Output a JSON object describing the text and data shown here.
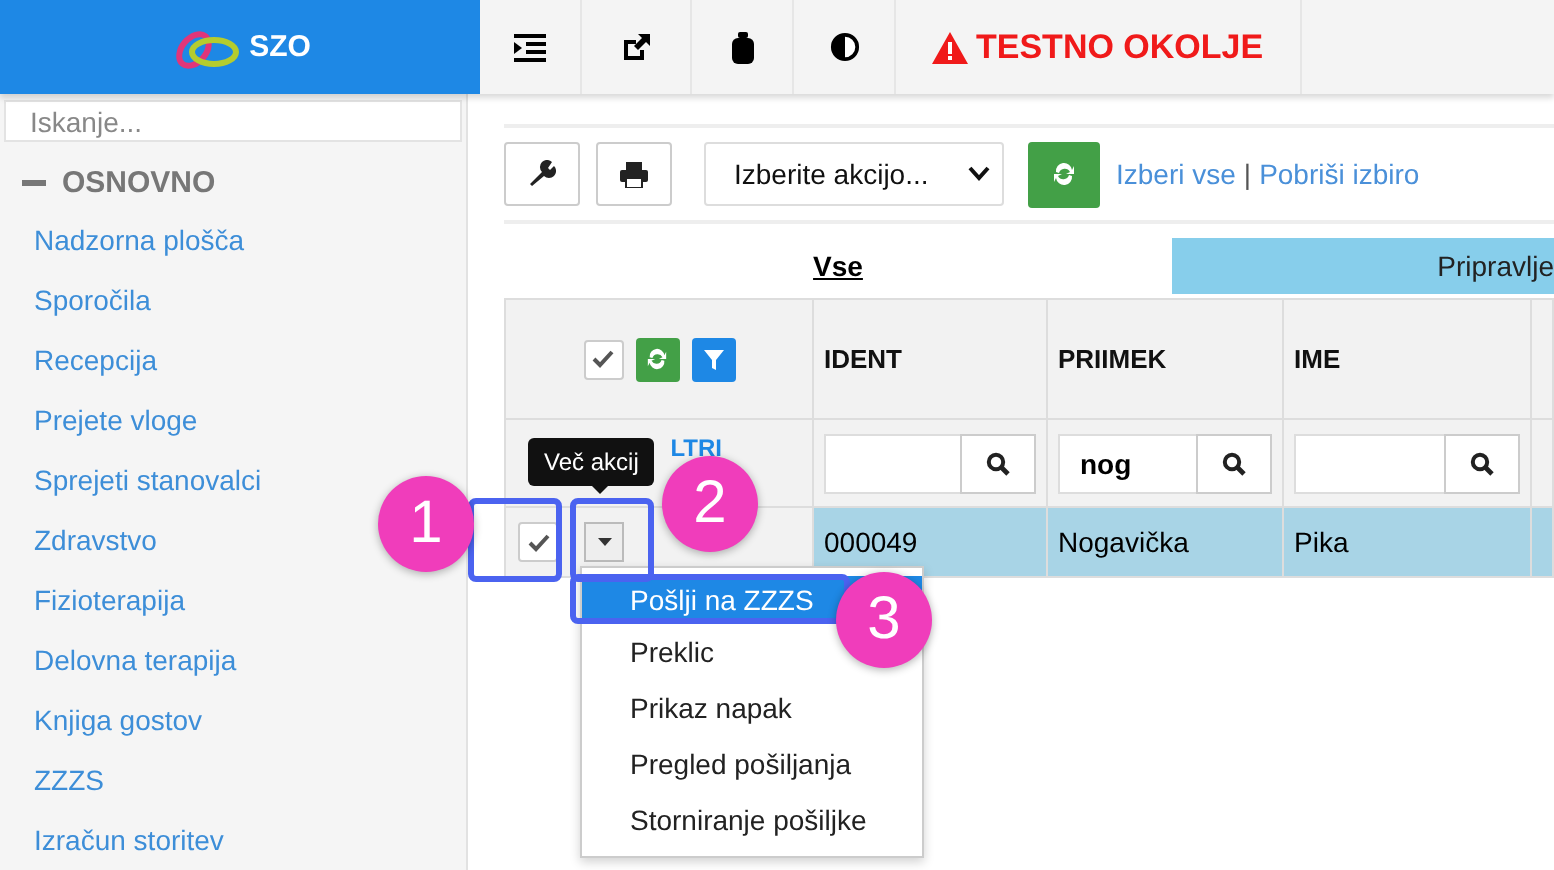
{
  "header": {
    "logo_text": "SZO",
    "alert": "TESTNO OKOLJE"
  },
  "sidebar": {
    "search": {
      "placeholder": "Iskanje..."
    },
    "section": {
      "label": "OSNOVNO",
      "expanded": true
    },
    "items": [
      "Nadzorna plošča",
      "Sporočila",
      "Recepcija",
      "Prejete vloge",
      "Sprejeti stanovalci",
      "Zdravstvo",
      "Fizioterapija",
      "Delovna terapija",
      "Knjiga gostov",
      "ZZZS",
      "Izračun storitev"
    ]
  },
  "toolbar": {
    "select": "Izberite akcijo...",
    "links": [
      "Izberi vse",
      "Pobriši izbiro"
    ],
    "separator": "|"
  },
  "tabs": [
    {
      "label": "Vse",
      "selected": true
    },
    {
      "label": "Pripravlje",
      "selected": false
    }
  ],
  "table": {
    "all_checked": true,
    "filters_label": "LTRI",
    "columns": [
      {
        "label": "IDENT"
      },
      {
        "label": "PRIIMEK",
        "filter": "nog"
      },
      {
        "label": "IME"
      }
    ],
    "rows": [
      {
        "checked": true,
        "selected": true,
        "cells": [
          "000049",
          "Nogavička",
          "Pika"
        ]
      }
    ]
  },
  "tooltip": "Več akcij",
  "menu": [
    {
      "label": "Pošlji na ZZZS",
      "selected": true
    },
    {
      "label": "Preklic",
      "selected": false
    },
    {
      "label": "Prikaz napak",
      "selected": false
    },
    {
      "label": "Pregled pošiljanja",
      "selected": false
    },
    {
      "label": "Storniranje pošiljke",
      "selected": false
    }
  ],
  "callouts": [
    "1",
    "2",
    "3"
  ]
}
